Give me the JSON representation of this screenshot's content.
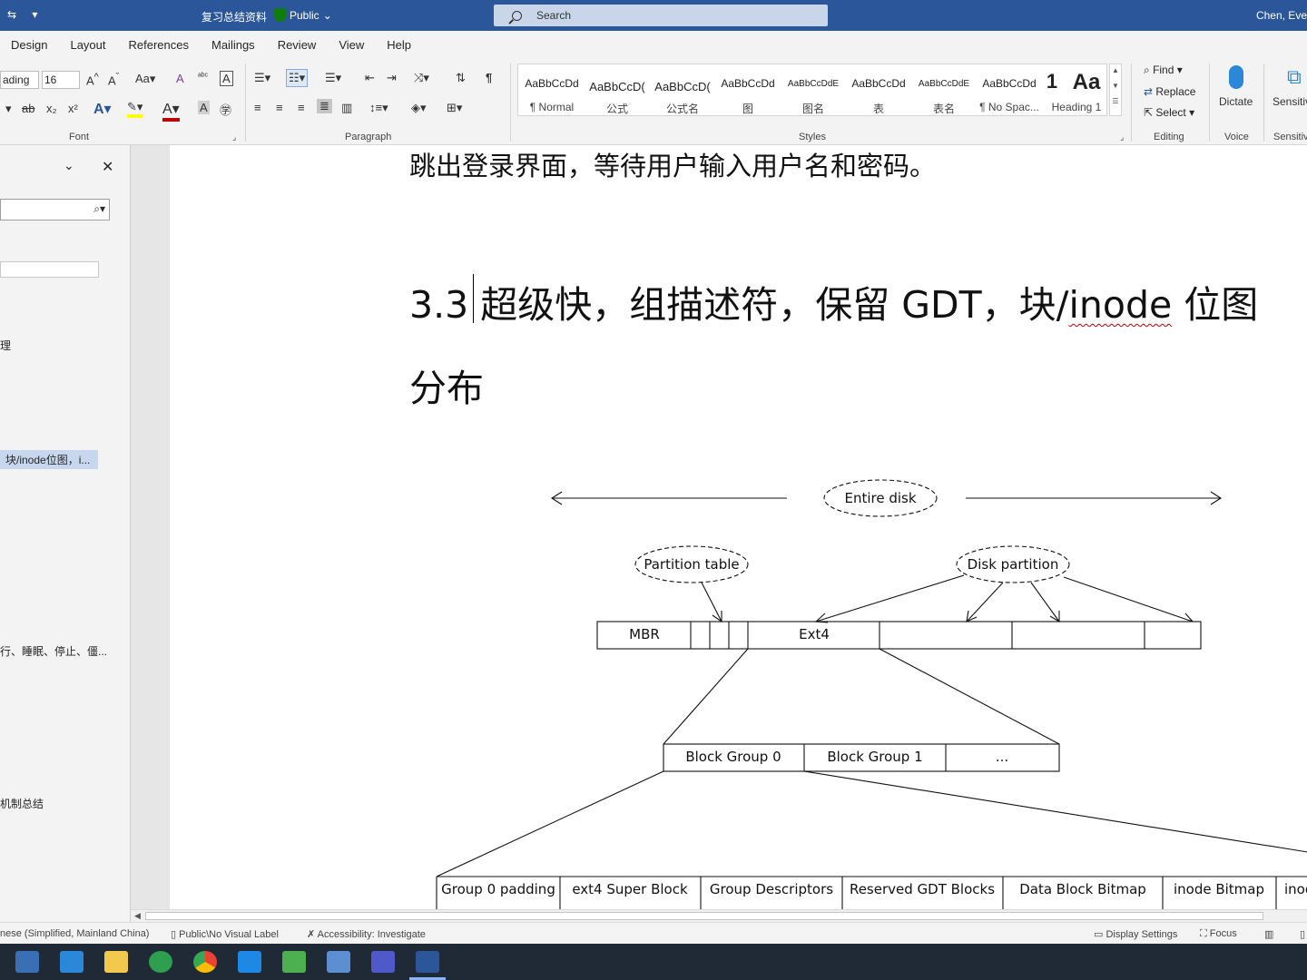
{
  "titlebar": {
    "qat_save": "⇆",
    "qat_more": "▾",
    "doc_title": "复习总结资料",
    "label": "Public",
    "search_placeholder": "Search",
    "user": "Chen, Eve"
  },
  "tabs": [
    "Design",
    "Layout",
    "References",
    "Mailings",
    "Review",
    "View",
    "Help"
  ],
  "ribbon": {
    "font": {
      "name_value": "ading",
      "size_value": "16",
      "label": "Font"
    },
    "paragraph": {
      "label": "Paragraph"
    },
    "styles": {
      "label": "Styles",
      "items": [
        {
          "sample": "AaBbCcDd",
          "name": "¶ Normal"
        },
        {
          "sample": "AaBbCcD(",
          "name": "公式"
        },
        {
          "sample": "AaBbCcD(",
          "name": "公式名"
        },
        {
          "sample": "AaBbCcDd",
          "name": "图"
        },
        {
          "sample": "AaBbCcDdE",
          "name": "图名"
        },
        {
          "sample": "AaBbCcDd",
          "name": "表"
        },
        {
          "sample": "AaBbCcDdE",
          "name": "表名"
        },
        {
          "sample": "AaBbCcDd",
          "name": "¶ No Spac..."
        },
        {
          "sample": "1",
          "name": "Heading 1"
        },
        {
          "sample": "Aa",
          "name": ""
        }
      ]
    },
    "editing": {
      "label": "Editing",
      "find": "Find",
      "replace": "Replace",
      "select": "Select"
    },
    "voice": {
      "label": "Voice",
      "dictate": "Dictate"
    },
    "sensitivity": {
      "label": "Sensitiv",
      "button": "Sensitiv"
    }
  },
  "navpane": {
    "items": [
      {
        "text": "理"
      },
      {
        "text": "块/inode位图，i..."
      },
      {
        "text": "行、睡眠、停止、僵..."
      },
      {
        "text": "机制总结"
      }
    ]
  },
  "document": {
    "first_line": "跳出登录界面，等待用户输入用户名和密码。",
    "heading_num": "3.3 ",
    "heading_a": "超级快，组描述符，保留 GDT，块/",
    "heading_b": "inode",
    "heading_c": " 位图",
    "heading_line2": "分布"
  },
  "diagram": {
    "entire_disk": "Entire disk",
    "partition_table": "Partition table",
    "disk_partition": "Disk partition",
    "mbr": "MBR",
    "ext4": "Ext4",
    "bg0": "Block Group 0",
    "bg1": "Block Group 1",
    "bg_more": "...",
    "fields": [
      "Group 0 padding",
      "ext4 Super Block",
      "Group Descriptors",
      "Reserved GDT Blocks",
      "Data Block Bitmap",
      "inode Bitmap",
      "inod"
    ]
  },
  "statusbar": {
    "language": "nese (Simplified, Mainland China)",
    "label": "Public\\No Visual Label",
    "accessibility": "Accessibility: Investigate",
    "display": "Display Settings",
    "focus": "Focus"
  },
  "colors": {
    "titlebar": "#2b579a",
    "taskbar": "#1f2a36"
  }
}
